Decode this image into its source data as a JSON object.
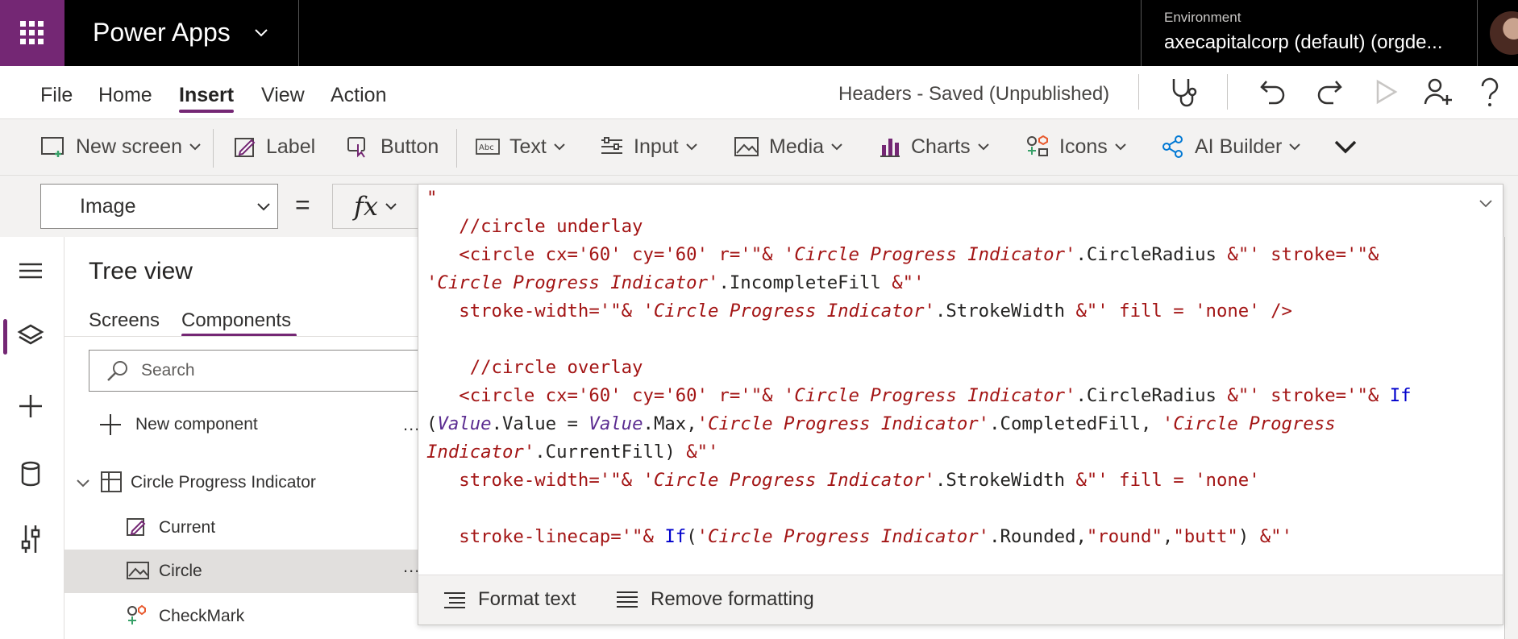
{
  "topbar": {
    "app_title": "Power Apps",
    "environment_label": "Environment",
    "environment_value": "axecapitalcorp (default) (orgde..."
  },
  "menu": {
    "items": [
      "File",
      "Home",
      "Insert",
      "View",
      "Action"
    ],
    "active": "Insert",
    "doc_status": "Headers - Saved (Unpublished)"
  },
  "ribbon": {
    "new_screen": "New screen",
    "label": "Label",
    "button": "Button",
    "text": "Text",
    "input": "Input",
    "media": "Media",
    "charts": "Charts",
    "icons": "Icons",
    "ai_builder": "AI Builder"
  },
  "formula": {
    "property": "Image",
    "equals": "=",
    "fx": "fx"
  },
  "tree": {
    "title": "Tree view",
    "tabs": [
      "Screens",
      "Components"
    ],
    "active_tab": "Components",
    "search_placeholder": "Search",
    "new_component": "New component",
    "component": "Circle Progress Indicator",
    "children": [
      "Current",
      "Circle",
      "CheckMark"
    ],
    "selected": "Circle",
    "more": "..."
  },
  "editor": {
    "footer": {
      "format_text": "Format text",
      "remove_formatting": "Remove formatting"
    }
  },
  "colors": {
    "brand": "#742774",
    "topbar": "#000000",
    "string": "#a31515",
    "keyword": "#0000cc"
  }
}
